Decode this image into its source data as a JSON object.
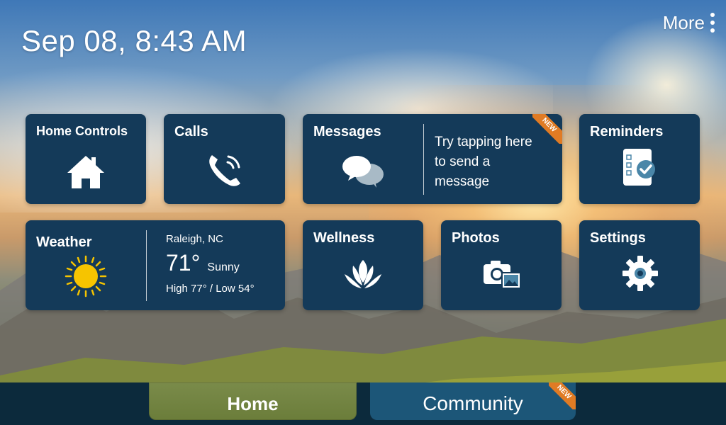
{
  "header": {
    "datetime": "Sep 08, 8:43 AM",
    "more_label": "More"
  },
  "tiles": {
    "home_controls": {
      "title": "Home Controls",
      "icon": "house-icon"
    },
    "calls": {
      "title": "Calls",
      "icon": "phone-icon"
    },
    "messages": {
      "title": "Messages",
      "icon": "chat-bubbles-icon",
      "hint_line1": "Try tapping here",
      "hint_line2": "to send a",
      "hint_line3": "message",
      "badge": "NEW"
    },
    "reminders": {
      "title": "Reminders",
      "icon": "checklist-icon"
    },
    "weather": {
      "title": "Weather",
      "icon": "sun-icon",
      "location": "Raleigh, NC",
      "temp": "71°",
      "condition": "Sunny",
      "range": "High 77° / Low 54°"
    },
    "wellness": {
      "title": "Wellness",
      "icon": "lotus-icon"
    },
    "photos": {
      "title": "Photos",
      "icon": "camera-icon"
    },
    "settings": {
      "title": "Settings",
      "icon": "gear-icon"
    }
  },
  "bottom_nav": {
    "home_label": "Home",
    "community_label": "Community",
    "community_badge": "NEW"
  },
  "colors": {
    "tile_bg": "#143a59",
    "badge_orange": "#e07b24",
    "bottom_bar": "#0c2a3c",
    "community_tab": "#1c5678",
    "check_accent": "#4a86a8"
  }
}
